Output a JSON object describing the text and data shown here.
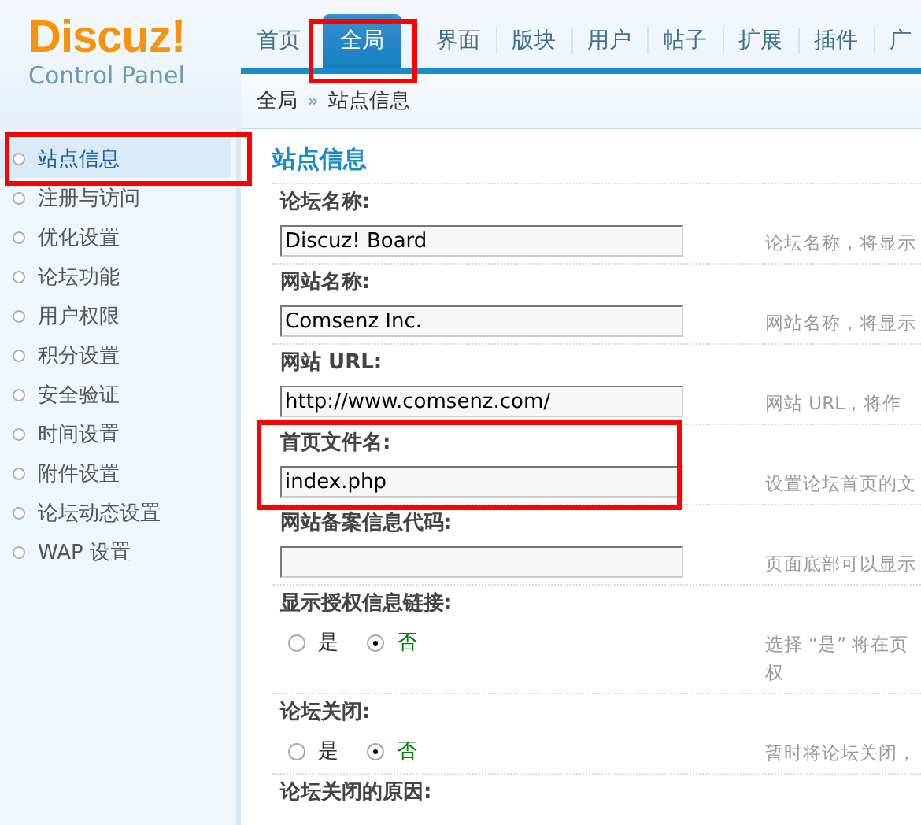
{
  "logo": {
    "name": "Discuz!",
    "subtitle": "Control Panel"
  },
  "nav": {
    "tabs": [
      {
        "label": "首页",
        "selected": false,
        "highlighted": false
      },
      {
        "label": "全局",
        "selected": true,
        "highlighted": true
      },
      {
        "label": "界面",
        "selected": false,
        "highlighted": false
      },
      {
        "label": "版块",
        "selected": false,
        "highlighted": false
      },
      {
        "label": "用户",
        "selected": false,
        "highlighted": false
      },
      {
        "label": "帖子",
        "selected": false,
        "highlighted": false
      },
      {
        "label": "扩展",
        "selected": false,
        "highlighted": false
      },
      {
        "label": "插件",
        "selected": false,
        "highlighted": false
      },
      {
        "label": "广",
        "selected": false,
        "highlighted": false
      }
    ]
  },
  "breadcrumb": {
    "items": [
      "全局",
      "站点信息"
    ],
    "separator": "»"
  },
  "sidebar": {
    "items": [
      {
        "label": "站点信息",
        "selected": true,
        "highlighted": true
      },
      {
        "label": "注册与访问",
        "selected": false,
        "highlighted": false
      },
      {
        "label": "优化设置",
        "selected": false,
        "highlighted": false
      },
      {
        "label": "论坛功能",
        "selected": false,
        "highlighted": false
      },
      {
        "label": "用户权限",
        "selected": false,
        "highlighted": false
      },
      {
        "label": "积分设置",
        "selected": false,
        "highlighted": false
      },
      {
        "label": "安全验证",
        "selected": false,
        "highlighted": false
      },
      {
        "label": "时间设置",
        "selected": false,
        "highlighted": false
      },
      {
        "label": "附件设置",
        "selected": false,
        "highlighted": false
      },
      {
        "label": "论坛动态设置",
        "selected": false,
        "highlighted": false
      },
      {
        "label": "WAP 设置",
        "selected": false,
        "highlighted": false
      }
    ]
  },
  "main": {
    "title": "站点信息",
    "settings": [
      {
        "kind": "text",
        "label": "论坛名称:",
        "value": "Discuz! Board",
        "hint_lines": [
          "论坛名称，将显示"
        ],
        "highlighted": false
      },
      {
        "kind": "text",
        "label": "网站名称:",
        "value": "Comsenz Inc.",
        "hint_lines": [
          "网站名称，将显示"
        ],
        "highlighted": false
      },
      {
        "kind": "text",
        "label": "网站  URL:",
        "value": "http://www.comsenz.com/",
        "hint_lines": [
          "网站  URL，将作"
        ],
        "highlighted": false
      },
      {
        "kind": "text",
        "label": "首页文件名:",
        "value": "index.php",
        "hint_lines": [
          "设置论坛首页的文"
        ],
        "highlighted": true
      },
      {
        "kind": "text",
        "label": "网站备案信息代码:",
        "hint_lines": [
          "页面底部可以显示"
        ],
        "highlighted": false
      },
      {
        "kind": "radio",
        "label": "显示授权信息链接:",
        "options": [
          {
            "label": "是",
            "selected": false
          },
          {
            "label": "否",
            "selected": true
          }
        ],
        "hint_lines": [
          "选择 “是” 将在页",
          "权"
        ],
        "highlighted": false
      },
      {
        "kind": "radio",
        "label": "论坛关闭:",
        "options": [
          {
            "label": "是",
            "selected": false
          },
          {
            "label": "否",
            "selected": true
          }
        ],
        "hint_lines": [
          "暂时将论坛关闭，"
        ],
        "highlighted": false
      },
      {
        "kind": "label",
        "label": "论坛关闭的原因:",
        "highlighted": false
      }
    ]
  }
}
